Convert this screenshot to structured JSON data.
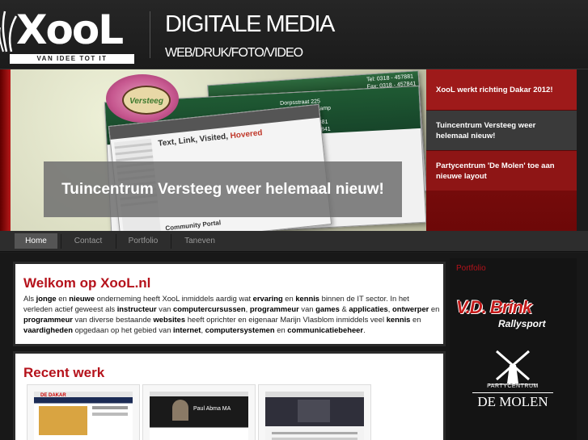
{
  "header": {
    "logo_text": "XooL",
    "logo_tagline": "VAN IDEE TOT IT",
    "title": "DIGITALE MEDIA",
    "subtitle": "WEB/DRUK/FOTO/VIDEO"
  },
  "slider": {
    "caption": "Tuincentrum Versteeg weer helemaal nieuw!",
    "preview": {
      "brand": "Versteeg",
      "heading_prefix": "Text, Link, Visited, ",
      "heading_hover": "Hovered",
      "address_line1": "Dorpsstraat 225",
      "address_line2": "0732 AD Hanskamp",
      "phone": "Tel: 0318 - 457881",
      "fax": "Fax: 0318 - 457841",
      "community": "Community Portal"
    },
    "news": [
      {
        "label": "XooL werkt richting Dakar 2012!",
        "active": false
      },
      {
        "label": "Tuincentrum Versteeg weer helemaal nieuw!",
        "active": true
      },
      {
        "label": "Partycentrum 'De Molen' toe aan nieuwe layout",
        "active": false
      }
    ]
  },
  "nav": {
    "items": [
      {
        "label": "Home",
        "active": true
      },
      {
        "label": "Contact",
        "active": false
      },
      {
        "label": "Portfolio",
        "active": false
      },
      {
        "label": "Taneven",
        "active": false
      }
    ]
  },
  "welcome": {
    "title": "Welkom op XooL.nl",
    "text": [
      {
        "t": "Als "
      },
      {
        "t": "jonge",
        "b": true
      },
      {
        "t": " en "
      },
      {
        "t": "nieuwe",
        "b": true
      },
      {
        "t": " onderneming heeft XooL inmiddels aardig wat "
      },
      {
        "t": "ervaring",
        "b": true
      },
      {
        "t": " en "
      },
      {
        "t": "kennis",
        "b": true
      },
      {
        "t": " binnen de IT sector. In het verleden actief geweest als "
      },
      {
        "t": "instructeur",
        "b": true
      },
      {
        "t": " van "
      },
      {
        "t": "computercursussen",
        "b": true
      },
      {
        "t": ", "
      },
      {
        "t": "programmeur",
        "b": true
      },
      {
        "t": " van "
      },
      {
        "t": "games",
        "b": true
      },
      {
        "t": " & "
      },
      {
        "t": "applicaties",
        "b": true
      },
      {
        "t": ", "
      },
      {
        "t": "ontwerper",
        "b": true
      },
      {
        "t": " en "
      },
      {
        "t": "programmeur",
        "b": true
      },
      {
        "t": " van diverse bestaande "
      },
      {
        "t": "websites",
        "b": true
      },
      {
        "t": " heeft oprichter en eigenaar Marijn Vlasblom inmiddels veel "
      },
      {
        "t": "kennis",
        "b": true
      },
      {
        "t": " en "
      },
      {
        "t": "vaardigheden",
        "b": true
      },
      {
        "t": " opgedaan op het gebied van "
      },
      {
        "t": "internet",
        "b": true
      },
      {
        "t": ", "
      },
      {
        "t": "computersystemen",
        "b": true
      },
      {
        "t": " en "
      },
      {
        "t": "communicatiebeheer",
        "b": true
      },
      {
        "t": "."
      }
    ]
  },
  "recent": {
    "title": "Recent werk",
    "thumbs": [
      {
        "name": "thumb-dakar",
        "banner": "DE DAKAR"
      },
      {
        "name": "thumb-person",
        "banner": "Paul Abma MA"
      },
      {
        "name": "thumb-molen",
        "banner": ""
      }
    ]
  },
  "portfolio": {
    "title": "Portfolio",
    "brink_main": "V.D. Brink",
    "brink_sub": "Rallysport",
    "molen_top": "PARTYCENTRUM",
    "molen_main": "DE MOLEN"
  },
  "colors": {
    "accent": "#b5121b",
    "slider_red": "#8d1414",
    "header_bg": "#1f1f1f"
  }
}
